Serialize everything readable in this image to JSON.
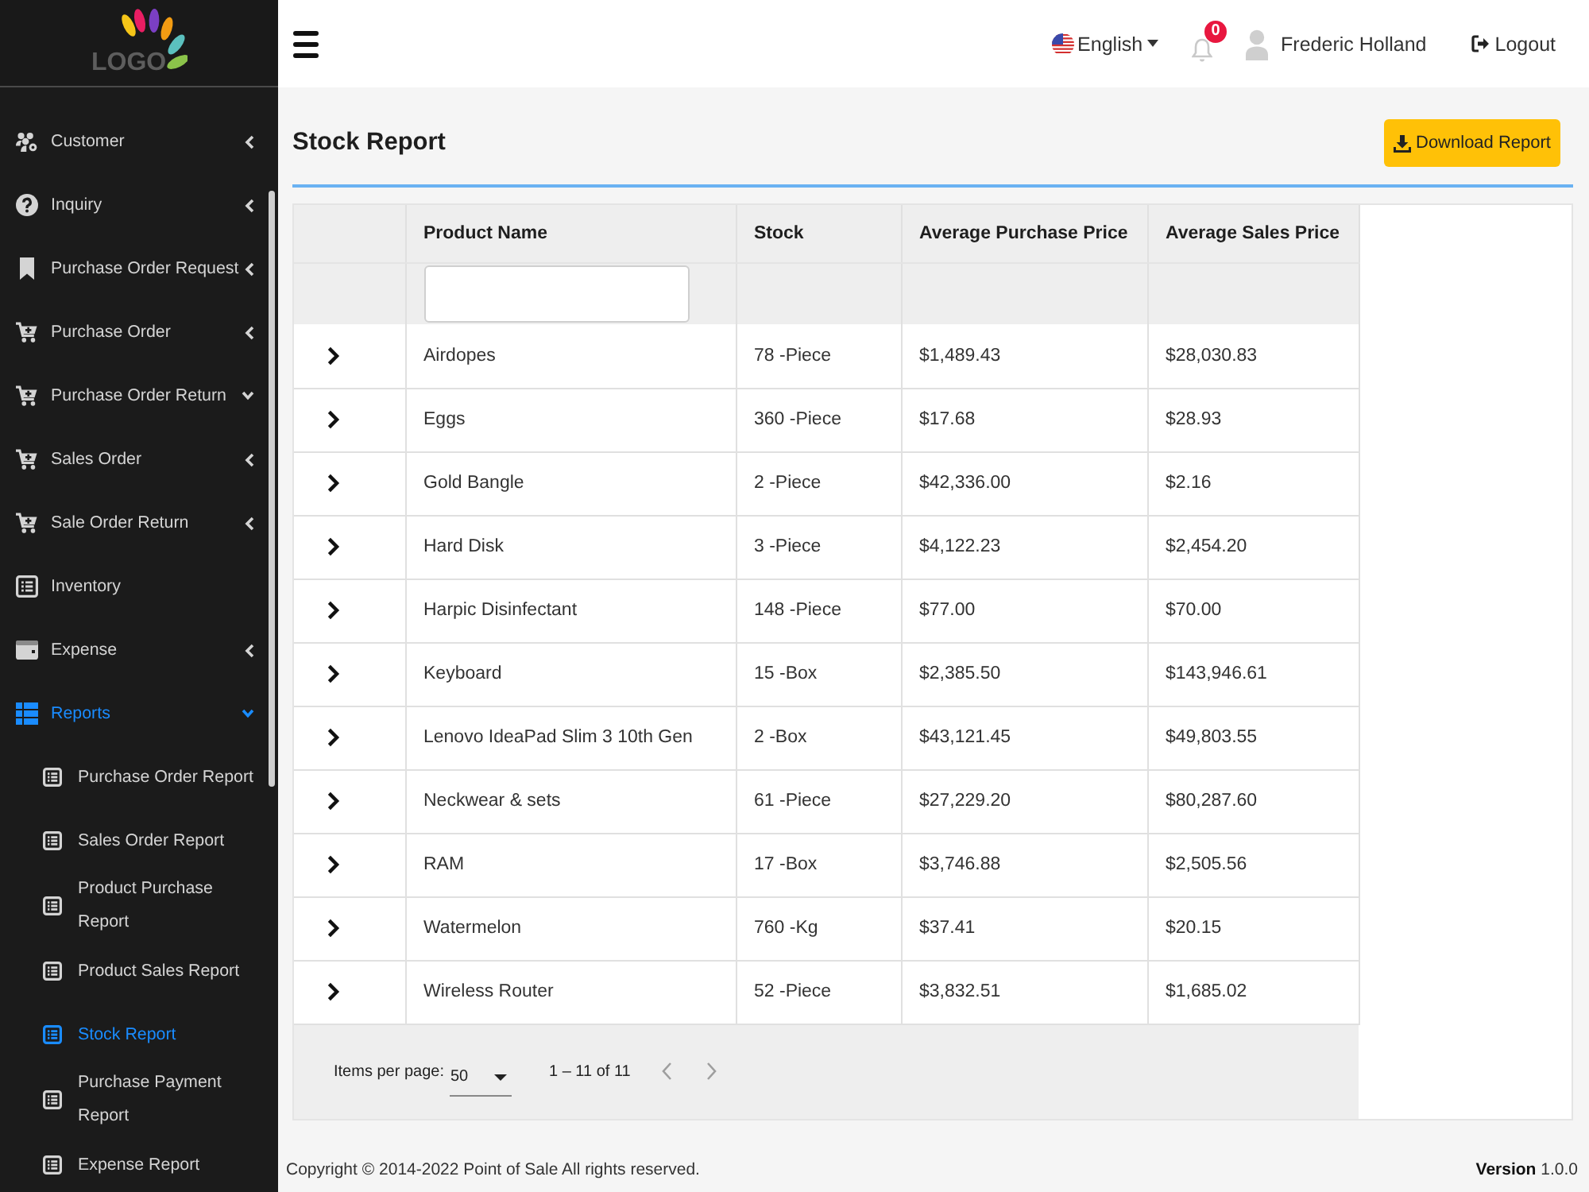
{
  "sidebar": {
    "logo": "LOGO",
    "items": [
      {
        "label": "Customer",
        "expanded": false,
        "selected": false
      },
      {
        "label": "Inquiry",
        "expanded": false,
        "selected": false
      },
      {
        "label": "Purchase Order Request",
        "expanded": false,
        "selected": false
      },
      {
        "label": "Purchase Order",
        "expanded": false,
        "selected": false
      },
      {
        "label": "Purchase Order Return",
        "expanded": true,
        "selected": false
      },
      {
        "label": "Sales Order",
        "expanded": false,
        "selected": false
      },
      {
        "label": "Sale Order Return",
        "expanded": false,
        "selected": false
      },
      {
        "label": "Inventory",
        "selected": false
      },
      {
        "label": "Expense",
        "expanded": false,
        "selected": false
      },
      {
        "label": "Reports",
        "expanded": true,
        "selected": true,
        "children": [
          {
            "label": "Purchase Order Report",
            "selected": false
          },
          {
            "label": "Sales Order Report",
            "selected": false
          },
          {
            "label": "Product Purchase Report",
            "selected": false
          },
          {
            "label": "Product Sales Report",
            "selected": false
          },
          {
            "label": "Stock Report",
            "selected": true
          },
          {
            "label": "Purchase Payment Report",
            "selected": false
          },
          {
            "label": "Expense Report",
            "selected": false
          }
        ]
      }
    ]
  },
  "topbar": {
    "language": "English",
    "notifications": "0",
    "user": "Frederic Holland",
    "logout": "Logout"
  },
  "page": {
    "title": "Stock Report",
    "download_button": "Download Report"
  },
  "table": {
    "columns": [
      "Product Name",
      "Stock",
      "Average Purchase Price",
      "Average Sales Price"
    ],
    "rows": [
      {
        "expanded": false,
        "cells": [
          "Airdopes",
          "78 -Piece",
          "$1,489.43",
          "$28,030.83"
        ]
      },
      {
        "expanded": false,
        "cells": [
          "Eggs",
          "360 -Piece",
          "$17.68",
          "$28.93"
        ]
      },
      {
        "expanded": false,
        "cells": [
          "Gold Bangle",
          "2 -Piece",
          "$42,336.00",
          "$2.16"
        ]
      },
      {
        "expanded": false,
        "cells": [
          "Hard Disk",
          "3 -Piece",
          "$4,122.23",
          "$2,454.20"
        ]
      },
      {
        "expanded": false,
        "cells": [
          "Harpic Disinfectant",
          "148 -Piece",
          "$77.00",
          "$70.00"
        ]
      },
      {
        "expanded": false,
        "cells": [
          "Keyboard",
          "15 -Box",
          "$2,385.50",
          "$143,946.61"
        ]
      },
      {
        "expanded": false,
        "cells": [
          "Lenovo IdeaPad Slim 3 10th Gen",
          "2 -Box",
          "$43,121.45",
          "$49,803.55"
        ]
      },
      {
        "expanded": false,
        "cells": [
          "Neckwear & sets",
          "61 -Piece",
          "$27,229.20",
          "$80,287.60"
        ]
      },
      {
        "expanded": false,
        "cells": [
          "RAM",
          "17 -Box",
          "$3,746.88",
          "$2,505.56"
        ]
      },
      {
        "expanded": false,
        "cells": [
          "Watermelon",
          "760 -Kg",
          "$37.41",
          "$20.15"
        ]
      },
      {
        "expanded": false,
        "cells": [
          "Wireless Router",
          "52 -Piece",
          "$3,832.51",
          "$1,685.02"
        ]
      }
    ]
  },
  "paginator": {
    "items_per_page_label": "Items per page:",
    "page_size": "50",
    "range": "1 – 11 of 11",
    "previous": {
      "disabled": true
    },
    "next": {
      "disabled": true
    }
  },
  "footer": {
    "copyright": "Copyright © 2014-2022 Point of Sale All rights reserved.",
    "version": "**Version** 1.0.0"
  }
}
